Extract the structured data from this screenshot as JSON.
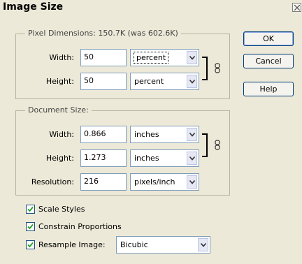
{
  "dialog": {
    "title": "Image Size"
  },
  "pixel_dimensions": {
    "label_prefix": "Pixel Dimensions:",
    "size_text": "150.7K (was 602.6K)",
    "width": {
      "label": "Width:",
      "value": "50",
      "unit": "percent"
    },
    "height": {
      "label": "Height:",
      "value": "50",
      "unit": "percent"
    }
  },
  "document_size": {
    "label": "Document Size:",
    "width": {
      "label": "Width:",
      "value": "0.866",
      "unit": "inches"
    },
    "height": {
      "label": "Height:",
      "value": "1.273",
      "unit": "inches"
    },
    "resolution": {
      "label": "Resolution:",
      "value": "216",
      "unit": "pixels/inch"
    }
  },
  "options": {
    "scale_styles": {
      "label": "Scale Styles",
      "checked": true
    },
    "constrain_proportions": {
      "label": "Constrain Proportions",
      "checked": true
    },
    "resample_image": {
      "label": "Resample Image:",
      "checked": true,
      "method": "Bicubic"
    }
  },
  "buttons": {
    "ok": "OK",
    "cancel": "Cancel",
    "help": "Help"
  },
  "icons": {
    "close": "close-icon",
    "link": "chain-link-icon",
    "dropdown": "chevron-down-icon",
    "check": "checkmark-icon"
  }
}
